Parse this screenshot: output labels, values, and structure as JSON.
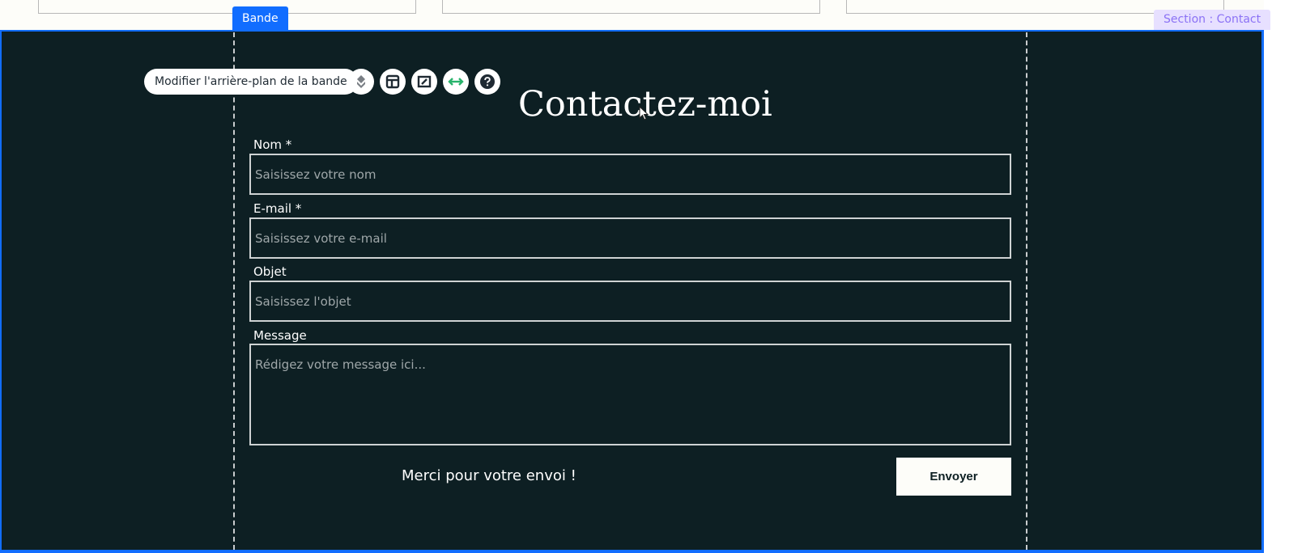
{
  "editor": {
    "strip_label": "Bande",
    "section_label": "Section : Contact",
    "toolbar": {
      "change_background_label": "Modifier l'arrière-plan de la bande",
      "icons": [
        "layers-icon",
        "layout-icon",
        "crop-icon",
        "stretch-icon",
        "help-icon"
      ],
      "accent": "#116dff",
      "stretch_color": "#29b36b"
    }
  },
  "contact": {
    "title": "Contactez-moi",
    "fields": [
      {
        "label": "Nom *",
        "placeholder": "Saisissez votre nom",
        "value": ""
      },
      {
        "label": "E-mail *",
        "placeholder": "Saisissez votre e-mail",
        "value": ""
      },
      {
        "label": "Objet",
        "placeholder": "Saisissez l'objet",
        "value": ""
      }
    ],
    "message": {
      "label": "Message",
      "placeholder": "Rédigez votre message ici...",
      "value": ""
    },
    "success_message": "Merci pour votre envoi !",
    "submit_label": "Envoyer",
    "colors": {
      "background": "#0d1f23",
      "text": "#ffffff",
      "button": "#fdfdf9"
    }
  }
}
